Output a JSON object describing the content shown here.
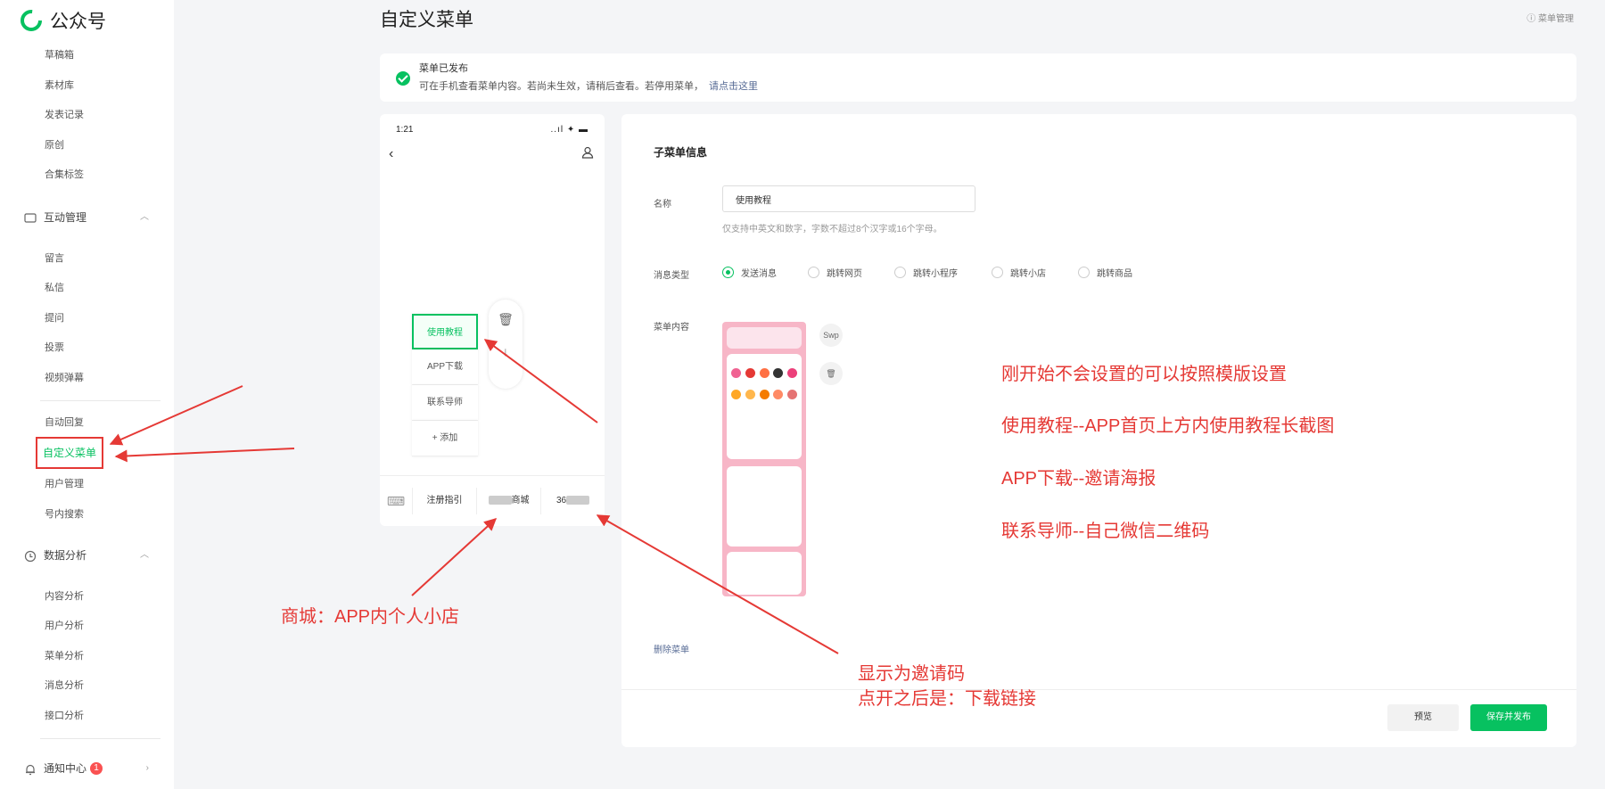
{
  "app": {
    "name": "公众号"
  },
  "sidebar": {
    "items_top": [
      "草稿箱",
      "素材库",
      "发表记录",
      "原创",
      "合集标签"
    ],
    "group_interact": "互动管理",
    "items_interact": [
      "留言",
      "私信",
      "提问",
      "投票",
      "视频弹幕"
    ],
    "items_mid": [
      "自动回复",
      "自定义菜单",
      "用户管理",
      "号内搜索"
    ],
    "group_data": "数据分析",
    "items_data": [
      "内容分析",
      "用户分析",
      "菜单分析",
      "消息分析",
      "接口分析"
    ],
    "notify": "通知中心",
    "notify_count": "1"
  },
  "header": {
    "title": "自定义菜单",
    "help": "菜单管理"
  },
  "notice": {
    "title": "菜单已发布",
    "desc": "可在手机查看菜单内容。若尚未生效，请稍后查看。若停用菜单，",
    "link": "请点击这里"
  },
  "phone": {
    "time": "1:21",
    "status": "..ıl ✦ ▬",
    "submenu": [
      "使用教程",
      "APP下载",
      "联系导师",
      "+ 添加"
    ],
    "menubar": [
      "注册指引",
      "商城",
      "36"
    ]
  },
  "editor": {
    "title": "子菜单信息",
    "name_label": "名称",
    "name_value": "使用教程",
    "name_hint": "仅支持中英文和数字，字数不超过8个汉字或16个字母。",
    "type_label": "消息类型",
    "types": [
      "发送消息",
      "跳转网页",
      "跳转小程序",
      "跳转小店",
      "跳转商品"
    ],
    "content_label": "菜单内容",
    "swap": "Swp",
    "delete_menu": "删除菜单",
    "preview": "预览",
    "publish": "保存并发布"
  },
  "annotations": {
    "a1": "刚开始不会设置的可以按照模版设置",
    "a2": "使用教程--APP首页上方内使用教程长截图",
    "a3": "APP下载--邀请海报",
    "a4": "联系导师--自己微信二维码",
    "a5": "商城：APP内个人小店",
    "a6": "显示为邀请码",
    "a7": "点开之后是：下载链接"
  },
  "colors": {
    "accent": "#07c160",
    "annotation": "#e53935",
    "link": "#576b95"
  }
}
